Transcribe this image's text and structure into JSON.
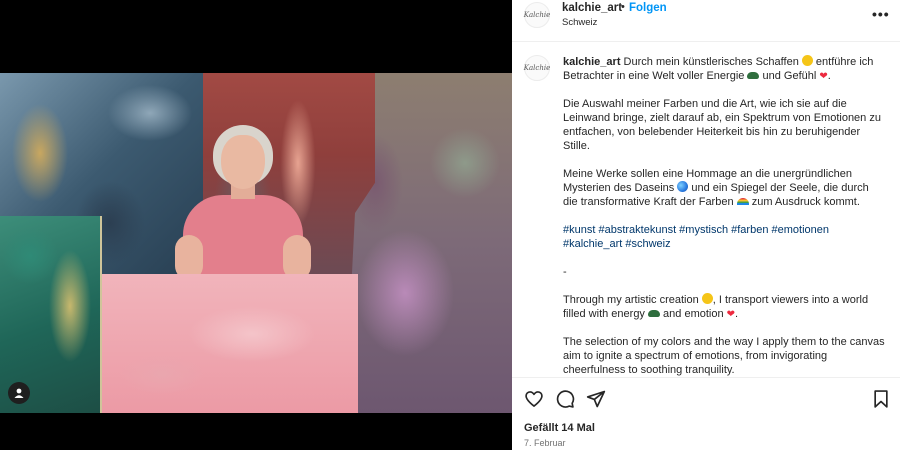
{
  "post": {
    "username": "kalchie_art",
    "follow_label": "Folgen",
    "separator": "•",
    "location": "Schweiz",
    "more_icon": "more-horizontal-icon",
    "avatar_text": "Kalchie"
  },
  "caption": {
    "username": "kalchie_art",
    "p1_a": " Durch mein künstlerisches Schaffen ",
    "p1_b": " entführe ich Betrachter in eine Welt voller Energie ",
    "p1_c": " und Gefühl ",
    "p2": "Die Auswahl meiner Farben und die Art, wie ich sie auf die Leinwand bringe, zielt darauf ab, ein Spektrum von Emotionen zu entfachen, von belebender Heiterkeit bis hin zu beruhigender Stille.",
    "p3_a": "Meine Werke sollen eine Hommage an die unergründlichen Mysterien des Daseins ",
    "p3_b": " und ein Spiegel der Seele, die durch die transformative Kraft der Farben ",
    "p3_c": " zum Ausdruck kommt.",
    "hashtags": "#kunst #abstraktekunst #mystisch #farben #emotionen #kalchie_art #schweiz",
    "divider": "-",
    "p4_a": "Through my artistic creation ",
    "p4_b": ", I transport viewers into a world filled with energy ",
    "p4_c": " and emotion ",
    "p5": "The selection of my colors and the way I apply them to the canvas aim to ignite a spectrum of emotions, from invigorating cheerfulness to soothing tranquility.",
    "heart_glyph": "❤"
  },
  "footer": {
    "likes": "Gefällt 14 Mal",
    "date": "7. Februar"
  },
  "colors": {
    "link_blue": "#0095f6",
    "hashtag": "#00376b",
    "text": "#262626",
    "muted": "#737373"
  },
  "icons": [
    "heart-icon",
    "comment-icon",
    "share-icon",
    "bookmark-icon",
    "user-tag-icon"
  ]
}
